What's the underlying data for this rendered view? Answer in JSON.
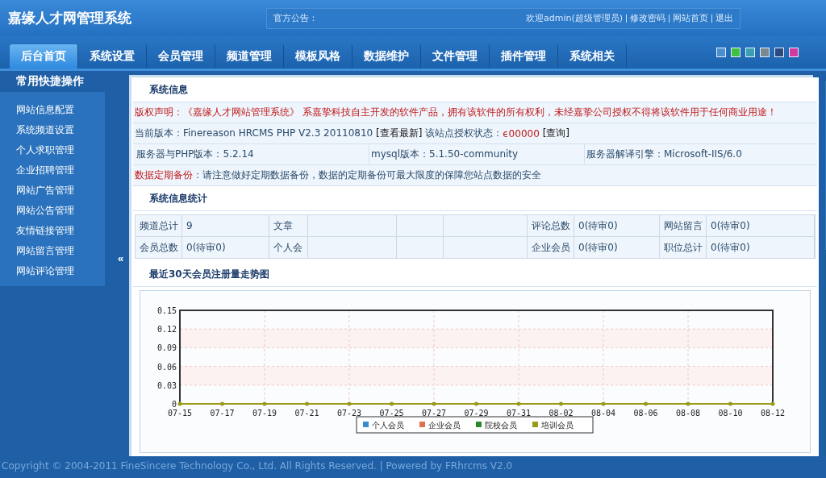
{
  "header": {
    "title": "嘉缘人才网管理系统",
    "notice_label": "官方公告：",
    "welcome": "欢迎admin(超级管理员)",
    "links": [
      "修改密码",
      "网站首页",
      "退出"
    ]
  },
  "nav": {
    "tabs": [
      {
        "label": "后台首页",
        "selected": true
      },
      {
        "label": "系统设置",
        "selected": false
      },
      {
        "label": "会员管理",
        "selected": false
      },
      {
        "label": "频道管理",
        "selected": false
      },
      {
        "label": "模板风格",
        "selected": false
      },
      {
        "label": "数据维护",
        "selected": false
      },
      {
        "label": "文件管理",
        "selected": false
      },
      {
        "label": "插件管理",
        "selected": false
      },
      {
        "label": "系统相关",
        "selected": false
      }
    ],
    "skins": [
      {
        "color": "#4a90d0"
      },
      {
        "color": "#40c040"
      },
      {
        "color": "#3aa0b0"
      },
      {
        "color": "#7a8890"
      },
      {
        "color": "#2a4a80"
      },
      {
        "color": "#d03aa0"
      }
    ]
  },
  "sidebar": {
    "title": "常用快捷操作",
    "items": [
      "网站信息配置",
      "系统频道设置",
      "个人求职管理",
      "企业招聘管理",
      "网站广告管理",
      "网站公告管理",
      "友情链接管理",
      "网站留言管理",
      "网站评论管理"
    ],
    "toggle": "«"
  },
  "system_info": {
    "title": "系统信息",
    "copyright_label": "版权声明：",
    "copyright_text": "《嘉缘人才网站管理系统》 系嘉挚科技自主开发的软件产品，拥有该软件的所有权利，未经嘉挚公司授权不得将该软件用于任何商业用途！",
    "version_label": "当前版本：",
    "version": "Finereason HRCMS PHP V2.3 20110810",
    "check_latest": "[查看最新]",
    "license_label": "该站点授权状态：",
    "license_status": "ϵ00000",
    "query": "[查询]",
    "server_php": "服务器与PHP版本：5.2.14",
    "mysql": "mysql版本：5.1.50-community",
    "engine": "服务器解译引擎：Microsoft-IIS/6.0",
    "backup_label": "数据定期备份",
    "backup_text": "：请注意做好定期数据备份，数据的定期备份可最大限度的保障您站点数据的安全"
  },
  "stats": {
    "title": "系统信息统计",
    "rows": [
      [
        "频道总计",
        "9",
        "文章",
        "",
        "",
        "",
        "评论总数",
        "0(待审0)",
        "网站留言",
        "0(待审0)"
      ],
      [
        "会员总数",
        "0(待审0)",
        "个人会",
        "",
        "",
        "",
        "企业会员",
        "0(待审0)",
        "职位总计",
        "0(待审0)"
      ]
    ]
  },
  "trend": {
    "title": "最近30天会员注册量走势图",
    "chart_data": {
      "type": "line",
      "categories": [
        "07-15",
        "07-17",
        "07-19",
        "07-21",
        "07-23",
        "07-25",
        "07-27",
        "07-29",
        "07-31",
        "08-02",
        "08-04",
        "08-06",
        "08-08",
        "08-10",
        "08-12"
      ],
      "ylim": [
        0,
        0.15
      ],
      "grid": true,
      "legend": "bottom",
      "yticks": [
        0,
        {
          "value": 0.03,
          "label": "0.03"
        },
        {
          "value": 0.06,
          "label": "0.06"
        },
        {
          "value": 0.09,
          "label": "0.09"
        },
        {
          "value": 0.12,
          "label": "0.12"
        },
        {
          "value": 0.15,
          "label": "0.15"
        }
      ],
      "series": [
        {
          "name": "个人会员",
          "color": "#3a8cc8",
          "values": [
            null,
            null,
            null,
            null,
            null,
            null,
            null,
            null,
            null,
            null,
            null,
            null,
            null,
            null,
            null
          ]
        },
        {
          "name": "企业会员",
          "color": "#e07050",
          "values": [
            null,
            null,
            null,
            null,
            null,
            null,
            null,
            null,
            null,
            null,
            null,
            null,
            null,
            null,
            null
          ]
        },
        {
          "name": "院校会员",
          "color": "#2a8a2a",
          "values": [
            null,
            null,
            null,
            null,
            null,
            null,
            null,
            null,
            null,
            null,
            null,
            null,
            null,
            null,
            null
          ]
        },
        {
          "name": "培训会员",
          "color": "#9a9a1a",
          "values": [
            0,
            0,
            0,
            0,
            0,
            0,
            0,
            0,
            0,
            0,
            0,
            0,
            0,
            0,
            0
          ]
        }
      ]
    }
  },
  "footer": "Copyright © 2004-2011 FineSincere Technology Co., Ltd. All Rights Reserved. | Powered by FRhrcms V2.0"
}
